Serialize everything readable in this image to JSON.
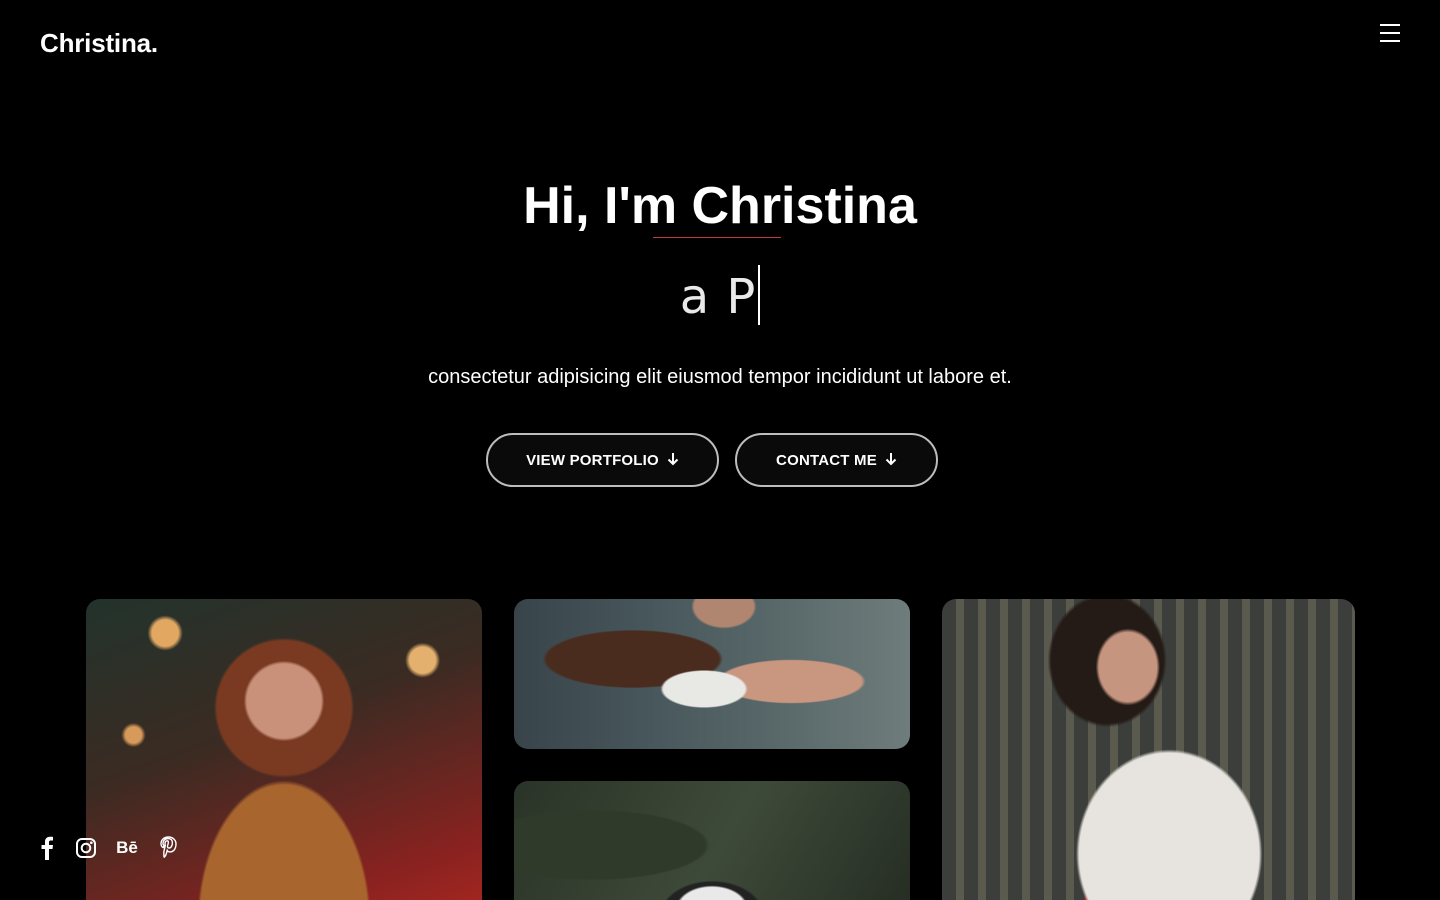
{
  "header": {
    "logo": "Christina."
  },
  "hero": {
    "title": "Hi, I'm Christina",
    "typed_text": "a P",
    "tagline": "consectetur adipisicing elit eiusmod tempor incididunt ut labore et."
  },
  "buttons": {
    "portfolio_label": "VIEW PORTFOLIO",
    "contact_label": "CONTACT ME",
    "arrow_icon": "arrow-down-icon"
  },
  "social": {
    "items": [
      {
        "name": "facebook-icon"
      },
      {
        "name": "instagram-icon"
      },
      {
        "name": "behance-icon",
        "label": "Bē"
      },
      {
        "name": "pinterest-icon"
      }
    ]
  },
  "colors": {
    "background": "#000000",
    "text": "#ffffff",
    "accent_underline": "#c23a3a",
    "button_border": "#bdbdbd"
  }
}
